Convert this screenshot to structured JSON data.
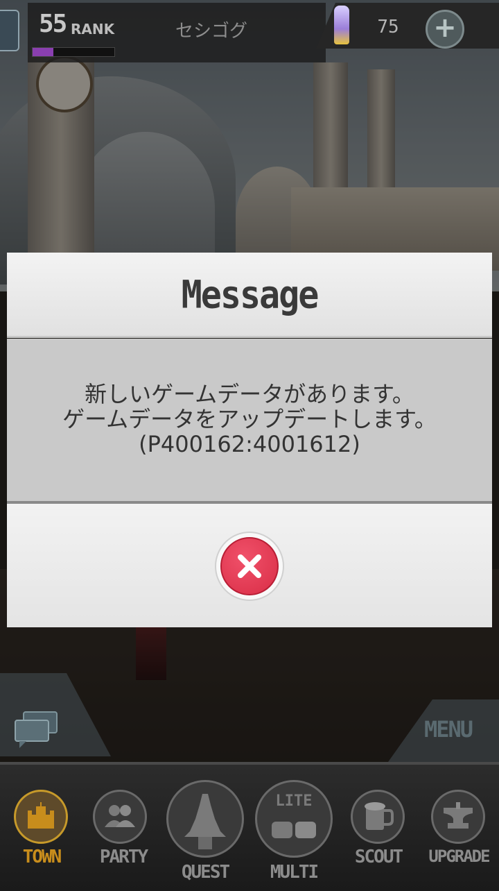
{
  "hud": {
    "rank_number": "55",
    "rank_label": "RANK",
    "exp_fraction": 0.25,
    "player_name": "セシゴグ",
    "gem_count": "75",
    "add_gems_symbol": "+"
  },
  "dialog": {
    "title": "Message",
    "line1": "新しいゲームデータがあります。",
    "line2": "ゲームデータをアップデートします。",
    "line3": "(P400162:4001612)",
    "close_icon": "close-icon"
  },
  "side": {
    "menu_label": "MENU",
    "chat_icon": "chat-bubbles-icon"
  },
  "nav": {
    "town": "TOWN",
    "party": "PARTY",
    "quest": "QUEST",
    "multi": "MULTI",
    "multi_badge": "LITE",
    "scout": "SCOUT",
    "upgrade": "UPGRADE",
    "active": "town"
  },
  "colors": {
    "close_red": "#e23a53",
    "town_active": "#c88d1c",
    "exp_purple": "#8a3fb0"
  }
}
